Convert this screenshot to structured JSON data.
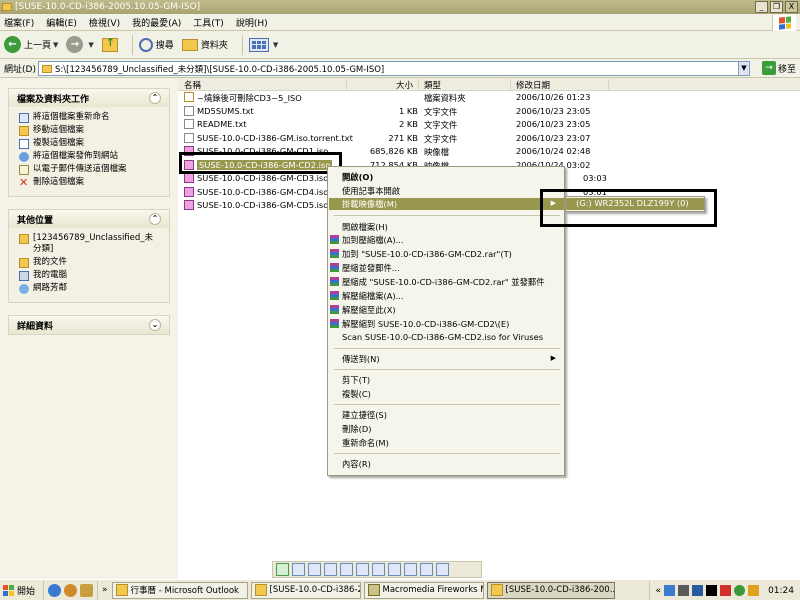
{
  "window": {
    "title": "[SUSE-10.0-CD-i386-2005.10.05-GM-ISO]",
    "controls": [
      "_",
      "❐",
      "X"
    ]
  },
  "menubar": {
    "items": [
      "檔案(F)",
      "編輯(E)",
      "檢視(V)",
      "我的最愛(A)",
      "工具(T)",
      "說明(H)"
    ]
  },
  "toolbar": {
    "back_label": "上一頁",
    "search_label": "搜尋",
    "folders_label": "資料夾"
  },
  "address": {
    "label": "網址(D)",
    "path": "S:\\[123456789_Unclassified_未分類]\\[SUSE-10.0-CD-i386-2005.10.05-GM-ISO]",
    "go_label": "移至"
  },
  "left": {
    "file_tasks": {
      "title": "檔案及資料夾工作",
      "items": [
        "將這個檔案重新命名",
        "移動這個檔案",
        "複製這個檔案",
        "將這個檔案發佈到網站",
        "以電子郵件傳送這個檔案",
        "刪除這個檔案"
      ]
    },
    "other_places": {
      "title": "其他位置",
      "items": [
        "[123456789_Unclassified_未分類]",
        "我的文件",
        "我的電腦",
        "網路芳鄰"
      ]
    },
    "details": {
      "title": "詳細資料"
    }
  },
  "columns": {
    "name": "名稱",
    "size": "大小",
    "type": "類型",
    "modified": "修改日期"
  },
  "files": [
    {
      "name": "~燒錄後可刪除CD3~5_ISO",
      "size": "",
      "type": "檔案資料夾",
      "modified": "2006/10/26 01:23",
      "icon": "folder"
    },
    {
      "name": "MD5SUMS.txt",
      "size": "1 KB",
      "type": "文字文件",
      "modified": "2006/10/23 23:05",
      "icon": "txt"
    },
    {
      "name": "README.txt",
      "size": "2 KB",
      "type": "文字文件",
      "modified": "2006/10/23 23:05",
      "icon": "txt"
    },
    {
      "name": "SUSE-10.0-CD-i386-GM.iso.torrent.txt",
      "size": "271 KB",
      "type": "文字文件",
      "modified": "2006/10/23 23:07",
      "icon": "txt"
    },
    {
      "name": "SUSE-10.0-CD-i386-GM-CD1.iso",
      "size": "685,826 KB",
      "type": "映像檔",
      "modified": "2006/10/24 02:48",
      "icon": "iso"
    },
    {
      "name": "SUSE-10.0-CD-i386-GM-CD2.iso",
      "size": "712,854 KB",
      "type": "映像檔",
      "modified": "2006/10/24 03:02",
      "icon": "iso"
    },
    {
      "name": "SUSE-10.0-CD-i386-GM-CD3.iso",
      "size": "",
      "type": "",
      "modified": "03:03",
      "icon": "iso"
    },
    {
      "name": "SUSE-10.0-CD-i386-GM-CD4.iso",
      "size": "",
      "type": "",
      "modified": "03:01",
      "icon": "iso"
    },
    {
      "name": "SUSE-10.0-CD-i386-GM-CD5.iso",
      "size": "",
      "type": "",
      "modified": "",
      "icon": "iso"
    }
  ],
  "context_menu": {
    "open": "開啟(O)",
    "open_notepad": "使用記事本開啟",
    "mount": "掛載映像檔(M)",
    "open_archive": "開啟檔案(H)",
    "add_archive": "加到壓縮檔(A)...",
    "add_rar": "加到 \"SUSE-10.0-CD-i386-GM-CD2.rar\"(T)",
    "compress_email": "壓縮並發郵件...",
    "compress_rar_email": "壓縮成 \"SUSE-10.0-CD-i386-GM-CD2.rar\" 並發郵件",
    "extract_files": "解壓縮檔案(A)...",
    "extract_here": "解壓縮至此(X)",
    "extract_to": "解壓縮到 SUSE-10.0-CD-i386-GM-CD2\\(E)",
    "scan": "Scan SUSE-10.0-CD-i386-GM-CD2.iso for Viruses",
    "send_to": "傳送到(N)",
    "cut": "剪下(T)",
    "copy": "複製(C)",
    "create_shortcut": "建立捷徑(S)",
    "delete": "刪除(D)",
    "rename": "重新命名(M)",
    "properties": "內容(R)"
  },
  "submenu": {
    "drive": "(G:) WR2352L DLZ199Y (0)"
  },
  "taskbar": {
    "start": "開始",
    "more": "»",
    "tasks": [
      "行事曆 - Microsoft Outlook",
      "[SUSE-10.0-CD-i386-200...",
      "Macromedia Fireworks M...",
      "[SUSE-10.0-CD-i386-200..."
    ],
    "tray_more": "«",
    "clock": "01:24"
  }
}
